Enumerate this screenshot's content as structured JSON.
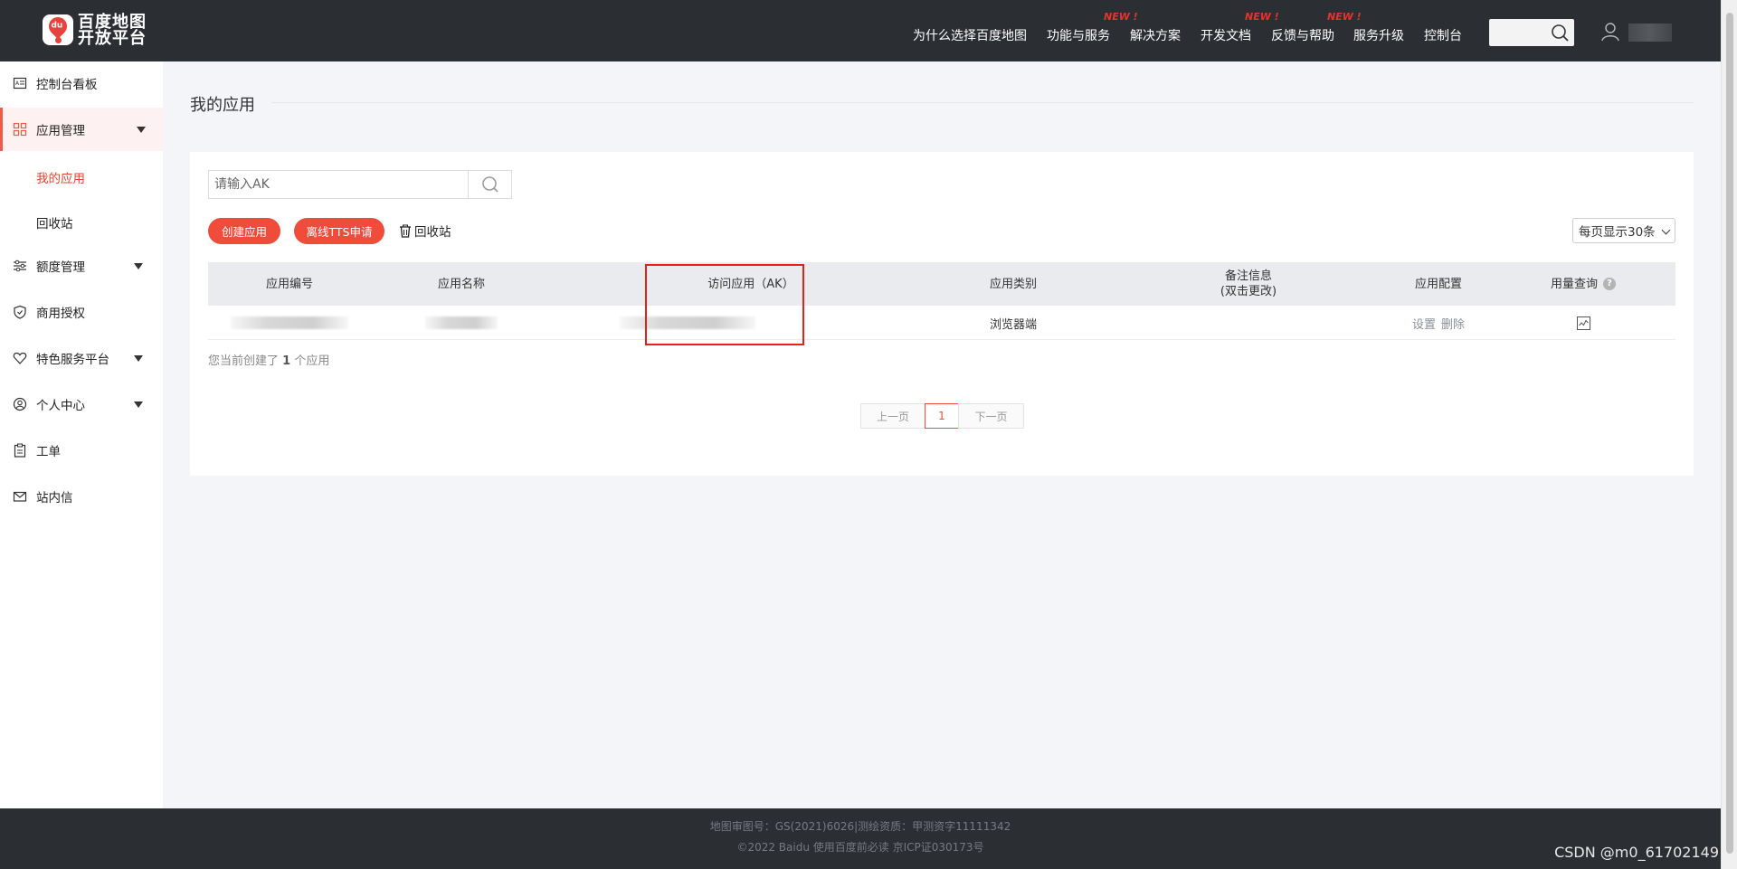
{
  "header": {
    "logo_line1": "百度地图",
    "logo_line2": "开放平台",
    "logo_badge": "du",
    "nav": [
      {
        "label": "为什么选择百度地图",
        "new": ""
      },
      {
        "label": "功能与服务",
        "new": "NEW !"
      },
      {
        "label": "解决方案",
        "new": ""
      },
      {
        "label": "开发文档",
        "new": "NEW !"
      },
      {
        "label": "反馈与帮助",
        "new": "NEW !"
      },
      {
        "label": "服务升级",
        "new": ""
      },
      {
        "label": "控制台",
        "new": ""
      }
    ],
    "search_icon": "search-icon",
    "user_icon": "user-icon"
  },
  "sidebar": {
    "items": [
      {
        "label": "控制台看板",
        "icon": "dashboard-icon"
      },
      {
        "label": "应用管理",
        "icon": "grid-icon"
      },
      {
        "label": "额度管理",
        "icon": "sliders-icon"
      },
      {
        "label": "商用授权",
        "icon": "shield-icon"
      },
      {
        "label": "特色服务平台",
        "icon": "heart-icon"
      },
      {
        "label": "个人中心",
        "icon": "user-circle-icon"
      },
      {
        "label": "工单",
        "icon": "clipboard-icon"
      },
      {
        "label": "站内信",
        "icon": "mail-icon"
      }
    ],
    "sub_items": [
      {
        "label": "我的应用"
      },
      {
        "label": "回收站"
      }
    ]
  },
  "main": {
    "title": "我的应用",
    "search_placeholder": "请输入AK",
    "create_button": "创建应用",
    "tts_button": "离线TTS申请",
    "recycle_link": "回收站",
    "page_size": "每页显示30条",
    "columns": [
      "应用编号",
      "应用名称",
      "访问应用（AK）",
      "应用类别",
      "备注信息",
      "(双击更改)",
      "应用配置",
      "用量查询"
    ],
    "rows": [
      {
        "category": "浏览器端",
        "op_settings": "设置",
        "op_delete": "删除"
      }
    ],
    "summary_prefix": "您当前创建了",
    "summary_count": "1",
    "summary_suffix": "个应用",
    "pager": {
      "prev": "上一页",
      "current": "1",
      "next": "下一页"
    }
  },
  "footer": {
    "line1": "地图审图号：GS(2021)6026|测绘资质：甲测资字11111342",
    "line2": "©2022 Baidu 使用百度前必读 京ICP证030173号"
  },
  "watermark": "CSDN @m0_61702149",
  "colors": {
    "accent": "#f04c3c",
    "navbar": "#2b2e33",
    "highlight": "#e6201a"
  }
}
